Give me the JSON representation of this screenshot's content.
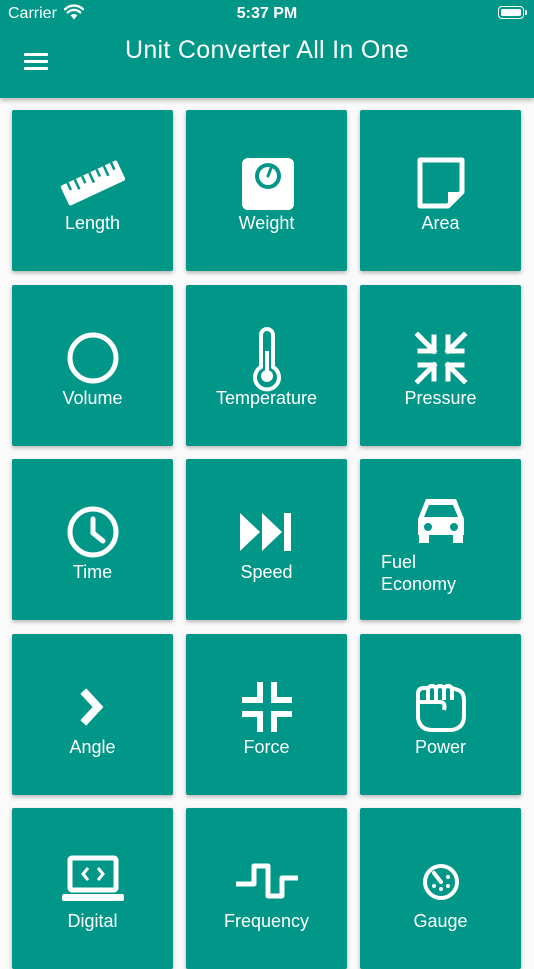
{
  "status_bar": {
    "carrier": "Carrier",
    "time": "5:37 PM"
  },
  "app_bar": {
    "title": "Unit Converter All In One",
    "menu_icon": "hamburger-menu-icon"
  },
  "categories": [
    {
      "label": "Length",
      "icon": "ruler-icon"
    },
    {
      "label": "Weight",
      "icon": "scale-icon"
    },
    {
      "label": "Area",
      "icon": "note-icon"
    },
    {
      "label": "Volume",
      "icon": "circle-icon"
    },
    {
      "label": "Temperature",
      "icon": "thermometer-icon"
    },
    {
      "label": "Pressure",
      "icon": "compress-arrows-icon"
    },
    {
      "label": "Time",
      "icon": "clock-icon"
    },
    {
      "label": "Speed",
      "icon": "fast-forward-icon"
    },
    {
      "label": "Fuel\nEconomy",
      "icon": "car-icon"
    },
    {
      "label": "Angle",
      "icon": "chevron-right-icon"
    },
    {
      "label": "Force",
      "icon": "compress-corners-icon"
    },
    {
      "label": "Power",
      "icon": "fist-icon"
    },
    {
      "label": "Digital",
      "icon": "laptop-code-icon"
    },
    {
      "label": "Frequency",
      "icon": "square-wave-icon"
    },
    {
      "label": "Gauge",
      "icon": "gauge-icon"
    }
  ],
  "colors": {
    "primary": "#009688",
    "on_primary": "#ffffff",
    "background": "#fafafa"
  }
}
